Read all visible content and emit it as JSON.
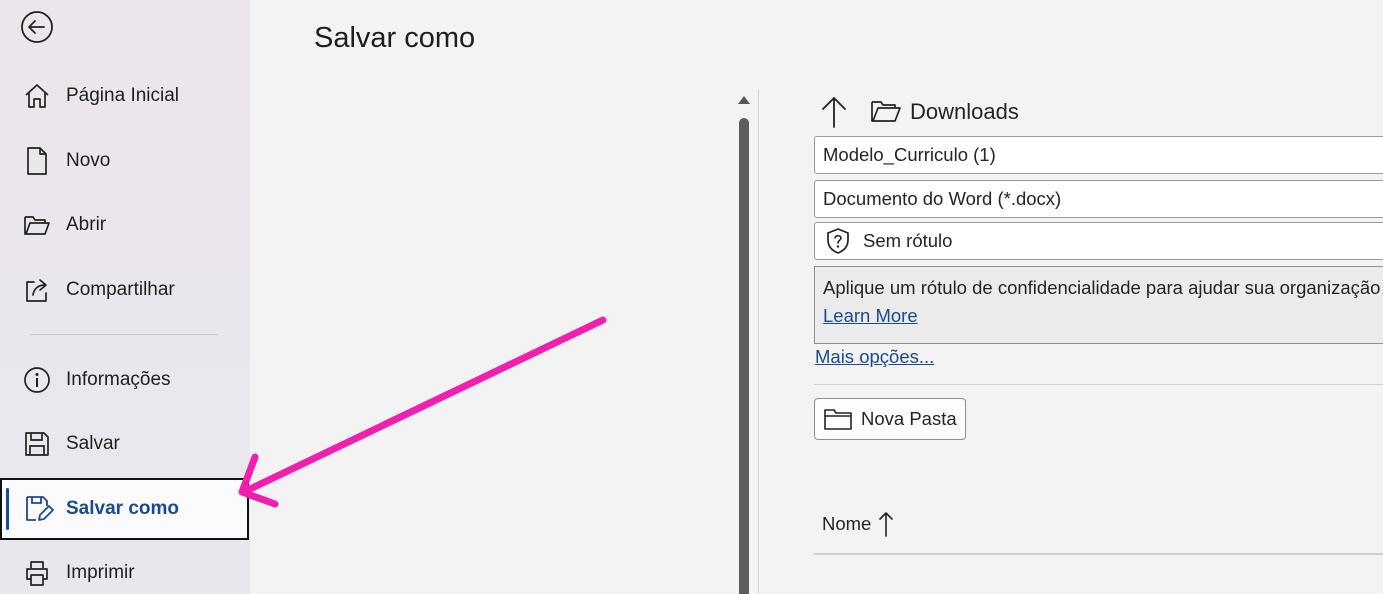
{
  "sidebar": {
    "items": [
      {
        "label": "Página Inicial",
        "icon": "home-icon"
      },
      {
        "label": "Novo",
        "icon": "new-document-icon"
      },
      {
        "label": "Abrir",
        "icon": "open-folder-icon"
      },
      {
        "label": "Compartilhar",
        "icon": "share-icon"
      },
      {
        "label": "Informações",
        "icon": "info-icon"
      },
      {
        "label": "Salvar",
        "icon": "save-icon"
      },
      {
        "label": "Salvar como",
        "icon": "save-as-icon",
        "active": true
      },
      {
        "label": "Imprimir",
        "icon": "printer-icon"
      }
    ]
  },
  "main": {
    "title": "Salvar como",
    "location": "Downloads",
    "file_name": "Modelo_Curriculo (1)",
    "file_type": "Documento do Word (*.docx)",
    "sensitivity_label": "Sem rótulo",
    "sensitivity_info": "Aplique um rótulo de confidencialidade para ajudar sua organização",
    "learn_more": "Learn More",
    "more_options": "Mais opções...",
    "new_folder": "Nova Pasta",
    "column_name": "Nome"
  },
  "colors": {
    "accent": "#1a4a91",
    "annotation_arrow": "#f11fb0"
  }
}
